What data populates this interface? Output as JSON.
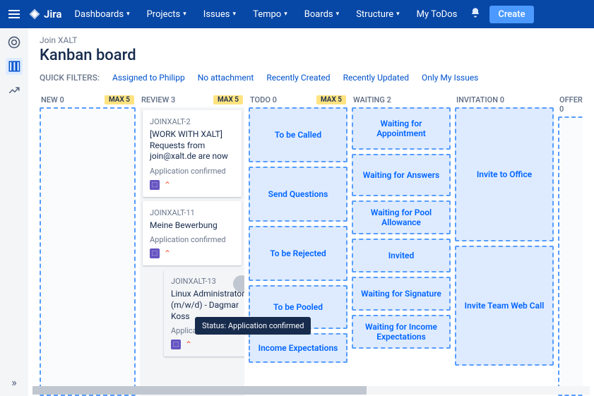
{
  "topbar": {
    "product": "Jira",
    "nav": [
      "Dashboards",
      "Projects",
      "Issues",
      "Tempo",
      "Boards",
      "Structure",
      "My ToDos"
    ],
    "create": "Create"
  },
  "breadcrumb": "Join XALT",
  "title": "Kanban board",
  "filters": {
    "label": "QUICK FILTERS:",
    "items": [
      "Assigned to Philipp",
      "No attachment",
      "Recently Created",
      "Recently Updated",
      "Only My Issues"
    ]
  },
  "columns": [
    {
      "name": "NEW",
      "count": 0,
      "max": "MAX 5"
    },
    {
      "name": "REVIEW",
      "count": 3,
      "max": "MAX 5"
    },
    {
      "name": "TODO",
      "count": 0,
      "max": "MAX 5"
    },
    {
      "name": "WAITING",
      "count": 2,
      "max": ""
    },
    {
      "name": "INVITATION",
      "count": 0,
      "max": ""
    },
    {
      "name": "OFFER",
      "count": 0,
      "max": ""
    }
  ],
  "review_cards": [
    {
      "key": "JOINXALT-2",
      "title": "[WORK WITH XALT] Requests from join@xalt.de are now",
      "status": "Application confirmed"
    },
    {
      "key": "JOINXALT-11",
      "title": "Meine Bewerbung",
      "status": "Application confirmed"
    },
    {
      "key": "JOINXALT-13",
      "title": "Linux Administrator (m/w/d) - Dagmar Koss",
      "status": "Application confirmed"
    }
  ],
  "todo_zones": [
    "To be Called",
    "Send Questions",
    "To be Rejected",
    "To be Pooled",
    "Income Expectations"
  ],
  "waiting_zones": [
    "Waiting for Appointment",
    "Waiting for Answers",
    "Waiting for Pool Allowance",
    "Invited",
    "Waiting for Signature",
    "Waiting for Income Expectations"
  ],
  "invitation_zones": [
    "Invite to Office",
    "Invite Team Web Call"
  ],
  "tooltip": "Status: Application confirmed"
}
